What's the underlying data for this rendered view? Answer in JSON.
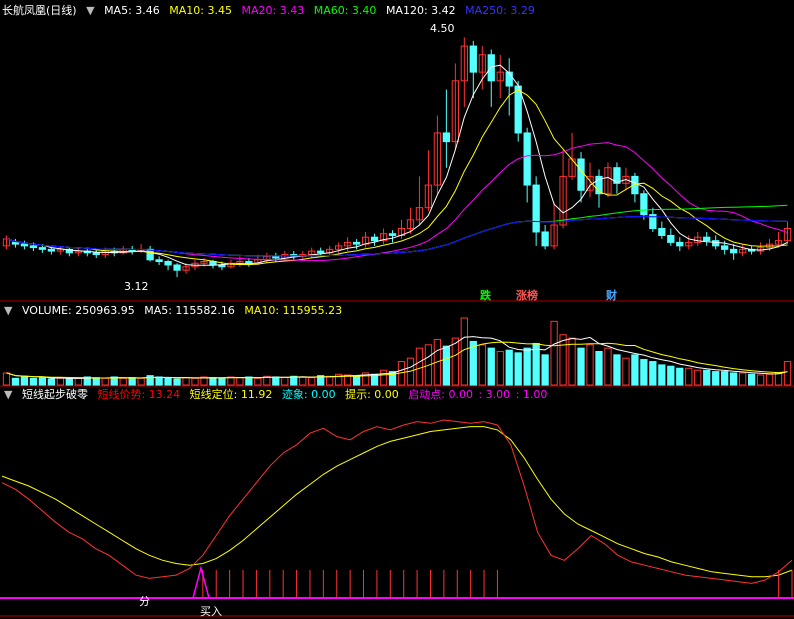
{
  "header": {
    "title": "长航凤凰(日线)",
    "ma": [
      {
        "label": "MA5: 3.46",
        "color": "#ffffff"
      },
      {
        "label": "MA10: 3.45",
        "color": "#ffff00"
      },
      {
        "label": "MA20: 3.43",
        "color": "#ff00ff"
      },
      {
        "label": "MA60: 3.40",
        "color": "#00ff00"
      },
      {
        "label": "MA120: 3.42",
        "color": "#ffffff"
      },
      {
        "label": "MA250: 3.29",
        "color": "#0000ff"
      }
    ]
  },
  "annotations": {
    "high": "4.50",
    "low": "3.12",
    "markers": [
      {
        "text": "跌",
        "color": "#00ff00"
      },
      {
        "text": "涨榜",
        "color": "#ff5050"
      },
      {
        "text": "财",
        "color": "#40a0ff"
      }
    ]
  },
  "volume_header": [
    {
      "label": "VOLUME: 250963.95",
      "color": "#ffffff"
    },
    {
      "label": "MA5: 115582.16",
      "color": "#ffffff"
    },
    {
      "label": "MA10: 115955.23",
      "color": "#ffff00"
    }
  ],
  "indicator_header": [
    {
      "label": "短线起步破零",
      "color": "#ffffff"
    },
    {
      "label": "短线价势: 13.24",
      "color": "#ff0000"
    },
    {
      "label": "短线定位: 11.92",
      "color": "#ffff00"
    },
    {
      "label": "迹象: 0.00",
      "color": "#00ffff"
    },
    {
      "label": "提示: 0.00",
      "color": "#ffff00"
    },
    {
      "label": "启动点: 0.00",
      "color": "#ff00ff"
    },
    {
      "label": ": 3.00",
      "color": "#ff00ff"
    },
    {
      "label": ": 1.00",
      "color": "#ff00ff"
    }
  ],
  "indicator_labels": {
    "fen": "分",
    "buy": "买入"
  },
  "colors": {
    "up": "#ff3232",
    "down": "#54ffff",
    "ma5": "#ffffff",
    "ma10": "#ffff00",
    "ma20": "#ff00ff",
    "ma60": "#00ff00",
    "ma120": "#c8c8c8",
    "ma250": "#0000ff",
    "axis": "#b00000"
  },
  "chart_data": {
    "type": "candlestick",
    "ylim": [
      3.0,
      4.6
    ],
    "candles": [
      [
        3.3,
        3.34,
        3.36,
        3.28
      ],
      [
        3.32,
        3.31,
        3.34,
        3.29
      ],
      [
        3.31,
        3.3,
        3.33,
        3.28
      ],
      [
        3.3,
        3.29,
        3.32,
        3.27
      ],
      [
        3.29,
        3.28,
        3.31,
        3.26
      ],
      [
        3.28,
        3.27,
        3.3,
        3.25
      ],
      [
        3.27,
        3.28,
        3.3,
        3.25
      ],
      [
        3.28,
        3.26,
        3.29,
        3.24
      ],
      [
        3.26,
        3.27,
        3.29,
        3.24
      ],
      [
        3.27,
        3.26,
        3.29,
        3.24
      ],
      [
        3.26,
        3.25,
        3.28,
        3.23
      ],
      [
        3.25,
        3.27,
        3.29,
        3.23
      ],
      [
        3.27,
        3.26,
        3.29,
        3.24
      ],
      [
        3.26,
        3.28,
        3.3,
        3.25
      ],
      [
        3.28,
        3.27,
        3.3,
        3.25
      ],
      [
        3.27,
        3.28,
        3.31,
        3.26
      ],
      [
        3.28,
        3.22,
        3.3,
        3.21
      ],
      [
        3.22,
        3.21,
        3.24,
        3.19
      ],
      [
        3.21,
        3.19,
        3.22,
        3.16
      ],
      [
        3.19,
        3.16,
        3.2,
        3.12
      ],
      [
        3.16,
        3.18,
        3.2,
        3.14
      ],
      [
        3.18,
        3.2,
        3.22,
        3.16
      ],
      [
        3.2,
        3.21,
        3.23,
        3.18
      ],
      [
        3.21,
        3.19,
        3.22,
        3.17
      ],
      [
        3.19,
        3.18,
        3.21,
        3.16
      ],
      [
        3.18,
        3.2,
        3.22,
        3.17
      ],
      [
        3.2,
        3.21,
        3.24,
        3.18
      ],
      [
        3.21,
        3.2,
        3.23,
        3.18
      ],
      [
        3.2,
        3.22,
        3.25,
        3.19
      ],
      [
        3.22,
        3.24,
        3.26,
        3.2
      ],
      [
        3.24,
        3.23,
        3.26,
        3.21
      ],
      [
        3.23,
        3.25,
        3.27,
        3.21
      ],
      [
        3.25,
        3.24,
        3.27,
        3.22
      ],
      [
        3.24,
        3.25,
        3.27,
        3.22
      ],
      [
        3.25,
        3.27,
        3.29,
        3.23
      ],
      [
        3.27,
        3.26,
        3.29,
        3.24
      ],
      [
        3.26,
        3.28,
        3.3,
        3.24
      ],
      [
        3.28,
        3.3,
        3.32,
        3.26
      ],
      [
        3.3,
        3.32,
        3.35,
        3.27
      ],
      [
        3.32,
        3.31,
        3.34,
        3.28
      ],
      [
        3.31,
        3.35,
        3.38,
        3.29
      ],
      [
        3.35,
        3.33,
        3.37,
        3.3
      ],
      [
        3.33,
        3.37,
        3.4,
        3.31
      ],
      [
        3.37,
        3.36,
        3.39,
        3.32
      ],
      [
        3.36,
        3.4,
        3.45,
        3.34
      ],
      [
        3.4,
        3.45,
        3.52,
        3.37
      ],
      [
        3.45,
        3.52,
        3.7,
        3.42
      ],
      [
        3.52,
        3.65,
        3.85,
        3.5
      ],
      [
        3.65,
        3.95,
        4.05,
        3.6
      ],
      [
        3.95,
        3.9,
        4.2,
        3.75
      ],
      [
        3.9,
        4.25,
        4.35,
        3.85
      ],
      [
        4.25,
        4.45,
        4.5,
        4.1
      ],
      [
        4.45,
        4.3,
        4.48,
        4.15
      ],
      [
        4.3,
        4.4,
        4.45,
        4.2
      ],
      [
        4.4,
        4.25,
        4.43,
        4.1
      ],
      [
        4.25,
        4.3,
        4.4,
        4.15
      ],
      [
        4.3,
        4.22,
        4.38,
        4.05
      ],
      [
        4.22,
        3.95,
        4.25,
        3.9
      ],
      [
        3.95,
        3.65,
        3.98,
        3.55
      ],
      [
        3.65,
        3.38,
        3.7,
        3.3
      ],
      [
        3.38,
        3.3,
        3.42,
        3.28
      ],
      [
        3.3,
        3.42,
        3.55,
        3.28
      ],
      [
        3.42,
        3.7,
        3.85,
        3.4
      ],
      [
        3.7,
        3.8,
        3.95,
        3.68
      ],
      [
        3.8,
        3.62,
        3.84,
        3.55
      ],
      [
        3.62,
        3.7,
        3.78,
        3.58
      ],
      [
        3.7,
        3.6,
        3.74,
        3.52
      ],
      [
        3.6,
        3.75,
        3.78,
        3.58
      ],
      [
        3.75,
        3.66,
        3.78,
        3.6
      ],
      [
        3.66,
        3.7,
        3.75,
        3.62
      ],
      [
        3.7,
        3.6,
        3.72,
        3.55
      ],
      [
        3.6,
        3.48,
        3.62,
        3.45
      ],
      [
        3.48,
        3.4,
        3.52,
        3.38
      ],
      [
        3.4,
        3.36,
        3.44,
        3.34
      ],
      [
        3.36,
        3.32,
        3.4,
        3.3
      ],
      [
        3.32,
        3.3,
        3.35,
        3.27
      ],
      [
        3.3,
        3.32,
        3.36,
        3.28
      ],
      [
        3.32,
        3.35,
        3.38,
        3.3
      ],
      [
        3.35,
        3.33,
        3.38,
        3.3
      ],
      [
        3.33,
        3.3,
        3.36,
        3.28
      ],
      [
        3.3,
        3.28,
        3.33,
        3.25
      ],
      [
        3.28,
        3.26,
        3.31,
        3.22
      ],
      [
        3.26,
        3.28,
        3.31,
        3.24
      ],
      [
        3.28,
        3.27,
        3.3,
        3.25
      ],
      [
        3.27,
        3.29,
        3.32,
        3.25
      ],
      [
        3.29,
        3.31,
        3.34,
        3.27
      ],
      [
        3.31,
        3.33,
        3.38,
        3.29
      ],
      [
        3.33,
        3.4,
        3.44,
        3.31
      ]
    ],
    "volume": [
      0.18,
      0.1,
      0.12,
      0.1,
      0.11,
      0.09,
      0.1,
      0.09,
      0.1,
      0.12,
      0.11,
      0.1,
      0.12,
      0.1,
      0.11,
      0.1,
      0.14,
      0.12,
      0.1,
      0.09,
      0.11,
      0.1,
      0.12,
      0.11,
      0.1,
      0.12,
      0.11,
      0.12,
      0.1,
      0.13,
      0.12,
      0.11,
      0.13,
      0.12,
      0.11,
      0.14,
      0.13,
      0.16,
      0.15,
      0.13,
      0.18,
      0.16,
      0.22,
      0.2,
      0.35,
      0.4,
      0.55,
      0.6,
      0.68,
      0.58,
      0.7,
      1.0,
      0.65,
      0.6,
      0.55,
      0.5,
      0.52,
      0.48,
      0.55,
      0.62,
      0.45,
      0.95,
      0.75,
      0.7,
      0.55,
      0.6,
      0.5,
      0.55,
      0.45,
      0.4,
      0.45,
      0.38,
      0.35,
      0.3,
      0.28,
      0.25,
      0.25,
      0.22,
      0.22,
      0.2,
      0.2,
      0.18,
      0.18,
      0.16,
      0.15,
      0.16,
      0.18,
      0.35
    ],
    "indicator_red": [
      0.62,
      0.58,
      0.52,
      0.45,
      0.38,
      0.32,
      0.28,
      0.22,
      0.18,
      0.12,
      0.06,
      0.04,
      0.05,
      0.06,
      0.1,
      0.18,
      0.3,
      0.42,
      0.52,
      0.62,
      0.72,
      0.8,
      0.85,
      0.92,
      0.95,
      0.9,
      0.88,
      0.93,
      0.96,
      0.94,
      0.97,
      0.99,
      0.98,
      1.0,
      0.99,
      0.98,
      0.99,
      0.97,
      0.85,
      0.6,
      0.32,
      0.18,
      0.15,
      0.22,
      0.3,
      0.25,
      0.18,
      0.14,
      0.12,
      0.1,
      0.08,
      0.06,
      0.05,
      0.04,
      0.03,
      0.02,
      0.01,
      0.03,
      0.08,
      0.15
    ],
    "indicator_yellow": [
      0.66,
      0.63,
      0.6,
      0.56,
      0.52,
      0.47,
      0.42,
      0.37,
      0.32,
      0.27,
      0.22,
      0.18,
      0.15,
      0.13,
      0.12,
      0.13,
      0.16,
      0.21,
      0.27,
      0.34,
      0.41,
      0.48,
      0.55,
      0.61,
      0.67,
      0.72,
      0.76,
      0.8,
      0.84,
      0.87,
      0.89,
      0.91,
      0.93,
      0.94,
      0.95,
      0.96,
      0.96,
      0.94,
      0.88,
      0.77,
      0.64,
      0.52,
      0.43,
      0.37,
      0.33,
      0.29,
      0.25,
      0.22,
      0.19,
      0.17,
      0.14,
      0.12,
      0.1,
      0.08,
      0.07,
      0.06,
      0.05,
      0.05,
      0.06,
      0.09
    ]
  }
}
